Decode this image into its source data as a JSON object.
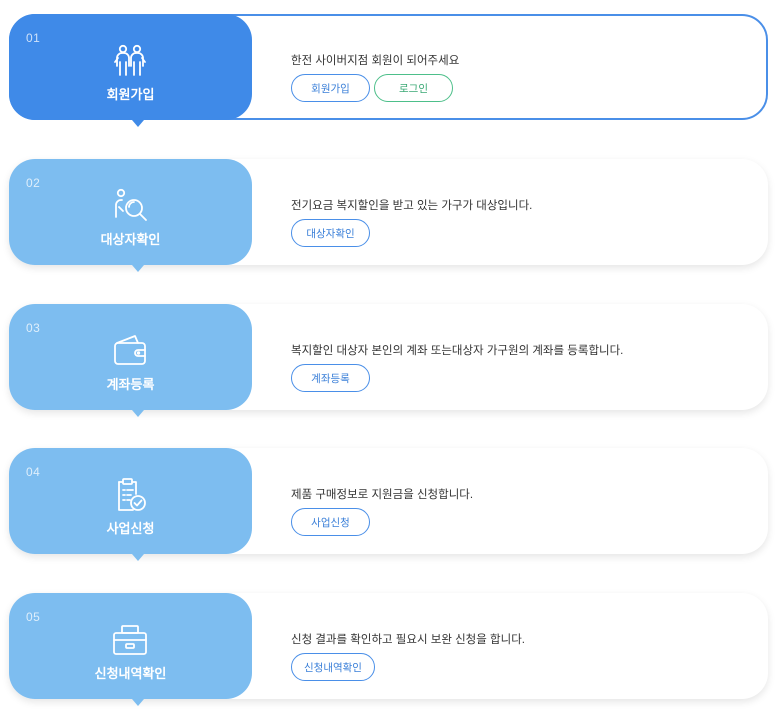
{
  "steps": [
    {
      "num": "01",
      "label": "회원가입",
      "icon": "user-group-icon",
      "desc": "한전 사이버지점 회원이 되어주세요",
      "buttons": [
        "회원가입",
        "로그인"
      ]
    },
    {
      "num": "02",
      "label": "대상자확인",
      "icon": "person-search-icon",
      "desc": "전기요금 복지할인을 받고 있는 가구가 대상입니다.",
      "buttons": [
        "대상자확인"
      ]
    },
    {
      "num": "03",
      "label": "계좌등록",
      "icon": "wallet-icon",
      "desc": "복지할인 대상자 본인의 계좌 또는대상자 가구원의 계좌를 등록합니다.",
      "buttons": [
        "계좌등록"
      ]
    },
    {
      "num": "04",
      "label": "사업신청",
      "icon": "clipboard-check-icon",
      "desc": "제품 구매정보로 지원금을 신청합니다.",
      "buttons": [
        "사업신청"
      ]
    },
    {
      "num": "05",
      "label": "신청내역확인",
      "icon": "toolbox-icon",
      "desc": "신청 결과를 확인하고 필요시 보완 신청을 합니다.",
      "buttons": [
        "신청내역확인"
      ]
    }
  ],
  "colors": {
    "active": "#3f8ae8",
    "inactive": "#7dbdf0",
    "border": "#4a8fe8",
    "login": "#4dbf8a"
  }
}
